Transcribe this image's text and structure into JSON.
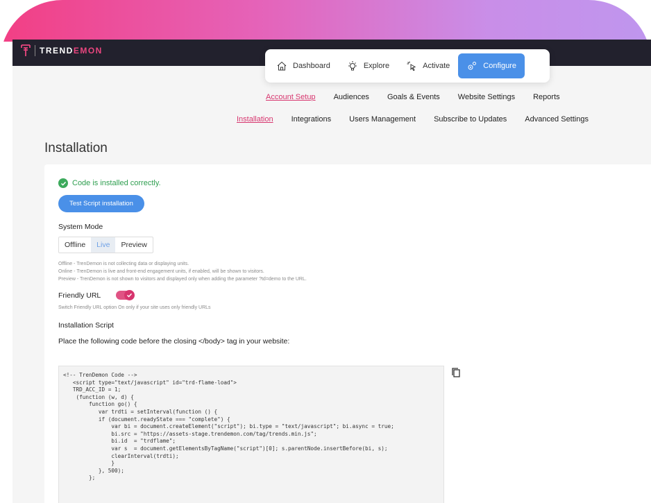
{
  "logo": {
    "prefix": "TREND",
    "suffix": "EMON"
  },
  "main_nav": [
    {
      "label": "Dashboard",
      "icon": "home-icon",
      "active": false
    },
    {
      "label": "Explore",
      "icon": "bulb-icon",
      "active": false
    },
    {
      "label": "Activate",
      "icon": "cursor-click-icon",
      "active": false
    },
    {
      "label": "Configure",
      "icon": "gears-icon",
      "active": true
    }
  ],
  "subnav1": [
    {
      "label": "Account Setup",
      "active": true
    },
    {
      "label": "Audiences",
      "active": false
    },
    {
      "label": "Goals & Events",
      "active": false
    },
    {
      "label": "Website Settings",
      "active": false
    },
    {
      "label": "Reports",
      "active": false
    }
  ],
  "subnav2": [
    {
      "label": "Installation",
      "active": true
    },
    {
      "label": "Integrations",
      "active": false
    },
    {
      "label": "Users Management",
      "active": false
    },
    {
      "label": "Subscribe to Updates",
      "active": false
    },
    {
      "label": "Advanced Settings",
      "active": false
    }
  ],
  "page": {
    "title": "Installation",
    "status_text": "Code is installed correctly.",
    "test_button": "Test Script installation",
    "system_mode_label": "System Mode",
    "modes": [
      {
        "label": "Offline",
        "active": false
      },
      {
        "label": "Live",
        "active": true
      },
      {
        "label": "Preview",
        "active": false
      }
    ],
    "mode_help": [
      "Offline - TrenDemon is not collecting data or displaying units.",
      "Online - TrenDemon is live and front-end engagement units, if enabled, will be shown to visitors.",
      "Preview - TrenDemon is not shown to visitors and displayed only when adding the parameter ?td=demo to the URL."
    ],
    "friendly_url_label": "Friendly URL",
    "friendly_url_on": true,
    "friendly_url_help": "Switch Friendly URL option On only if your site uses only friendly URLs",
    "installation_script_label": "Installation Script",
    "installation_instruction": "Place the following code before the closing </body> tag in your website:",
    "code": "<!-- TrenDemon Code -->\n   <script type=\"text/javascript\" id=\"trd-flame-load\">\n   TRD_ACC_ID = 1;\n    (function (w, d) {\n        function go() {\n           var trdti = setInterval(function () {\n           if (document.readyState === \"complete\") {\n               var bi = document.createElement(\"script\"); bi.type = \"text/javascript\"; bi.async = true;\n               bi.src = \"https://assets-stage.trendemon.com/tag/trends.min.js\";\n               bi.id  = \"trdflame\";\n               var s  = document.getElementsByTagName(\"script\")[0]; s.parentNode.insertBefore(bi, s);\n               clearInterval(trdti);\n               }\n           }, 500);\n        };"
  },
  "colors": {
    "accent": "#d7356e",
    "primary": "#4a90e8",
    "success": "#3daa5c",
    "topbar": "#22212d"
  }
}
